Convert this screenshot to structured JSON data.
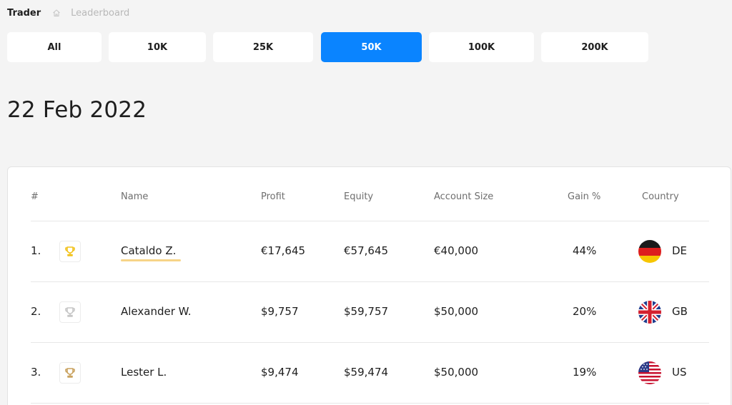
{
  "breadcrumb": {
    "root": "Trader",
    "current": "Leaderboard"
  },
  "filters": [
    {
      "label": "All",
      "active": false
    },
    {
      "label": "10K",
      "active": false
    },
    {
      "label": "25K",
      "active": false
    },
    {
      "label": "50K",
      "active": true
    },
    {
      "label": "100K",
      "active": false
    },
    {
      "label": "200K",
      "active": false
    }
  ],
  "date": "22 Feb 2022",
  "table": {
    "headers": [
      "#",
      "Name",
      "Profit",
      "Equity",
      "Account Size",
      "Gain %",
      "Country"
    ],
    "rows": [
      {
        "rank": "1.",
        "trophy": "gold-trophy-icon",
        "name": "Cataldo Z.",
        "profit": "€17,645",
        "equity": "€57,645",
        "account_size": "€40,000",
        "gain": "44%",
        "country": "DE",
        "flag": "germany-flag-icon"
      },
      {
        "rank": "2.",
        "trophy": "silver-trophy-icon",
        "name": "Alexander W.",
        "profit": "$9,757",
        "equity": "$59,757",
        "account_size": "$50,000",
        "gain": "20%",
        "country": "GB",
        "flag": "uk-flag-icon"
      },
      {
        "rank": "3.",
        "trophy": "bronze-trophy-icon",
        "name": "Lester L.",
        "profit": "$9,474",
        "equity": "$59,474",
        "account_size": "$50,000",
        "gain": "19%",
        "country": "US",
        "flag": "us-flag-icon"
      }
    ]
  },
  "colors": {
    "accent": "#0a84ff",
    "gold": "#f2c21b",
    "silver": "#c6c6c6",
    "bronze": "#c9a25e",
    "highlight": "#f7d488"
  }
}
